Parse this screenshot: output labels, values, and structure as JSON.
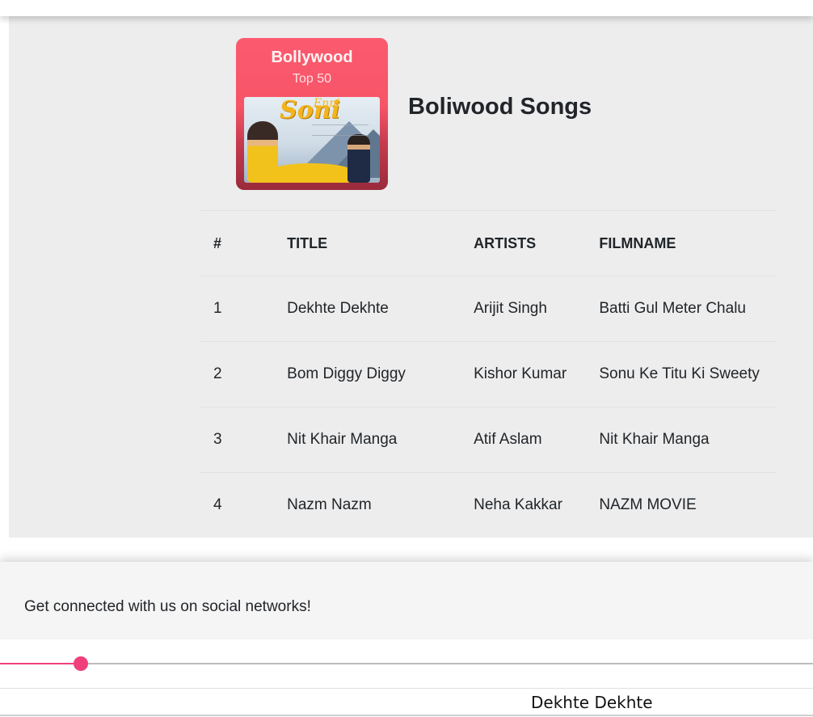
{
  "album": {
    "cover_title": "Bollywood",
    "cover_subtitle": "Top 50",
    "cover_art_logo": "Enni Soni"
  },
  "page": {
    "title": "Boliwood Songs"
  },
  "table": {
    "headers": [
      "#",
      "TITLE",
      "ARTISTS",
      "FILMNAME"
    ],
    "rows": [
      [
        "1",
        "Dekhte Dekhte",
        "Arijit Singh",
        "Batti Gul Meter Chalu"
      ],
      [
        "2",
        "Bom Diggy Diggy",
        "Kishor Kumar",
        "Sonu Ke Titu Ki Sweety"
      ],
      [
        "3",
        "Nit Khair Manga",
        "Atif Aslam",
        "Nit Khair Manga"
      ],
      [
        "4",
        "Nazm Nazm",
        "Neha Kakkar",
        "NAZM MOVIE"
      ]
    ]
  },
  "footer": {
    "text": "Get connected with us on social networks!"
  },
  "player": {
    "progress_fraction": 0.099,
    "now_playing": "Dekhte Dekhte",
    "accent_color": "#f0407a"
  },
  "colors": {
    "cover_pink": "#fb5a6f",
    "panel_bg": "#ededed"
  }
}
